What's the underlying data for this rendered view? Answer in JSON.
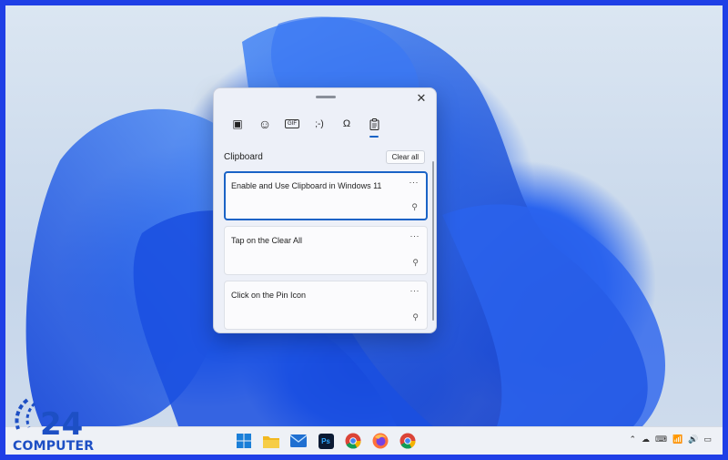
{
  "panel": {
    "close_label": "✕",
    "tabs": [
      {
        "icon": "heart-sticker-icon",
        "glyph": "▣"
      },
      {
        "icon": "emoji-icon",
        "glyph": "☺"
      },
      {
        "icon": "gif-icon",
        "glyph": "GIF"
      },
      {
        "icon": "kaomoji-icon",
        "glyph": ";-)"
      },
      {
        "icon": "symbols-icon",
        "glyph": "Ω"
      },
      {
        "icon": "clipboard-icon",
        "glyph": "📋",
        "active": true
      }
    ],
    "section_title": "Clipboard",
    "clear_all_label": "Clear all",
    "items": [
      {
        "text": "Enable and Use Clipboard in Windows 11",
        "more": "···",
        "pin": "⚲",
        "selected": true
      },
      {
        "text": "Tap on the Clear All",
        "more": "···",
        "pin": "⚲"
      },
      {
        "text": "Click on the Pin Icon",
        "more": "···",
        "pin": "⚲"
      }
    ]
  },
  "logo": {
    "number": "24",
    "text": "COMPUTER"
  },
  "taskbar": {
    "apps": [
      "windows-start-icon",
      "file-explorer-icon",
      "mail-icon",
      "photoshop-icon",
      "chrome-icon",
      "firefox-icon",
      "chrome-icon"
    ],
    "photoshop_label": "Ps",
    "tray": [
      "⌃",
      "☁",
      "⌨",
      "📶",
      "🔊",
      "▭"
    ]
  },
  "colors": {
    "accent": "#1a63c6",
    "wallpaper_blue": "#1c5cf0",
    "border_frame": "#1f3fe6"
  }
}
